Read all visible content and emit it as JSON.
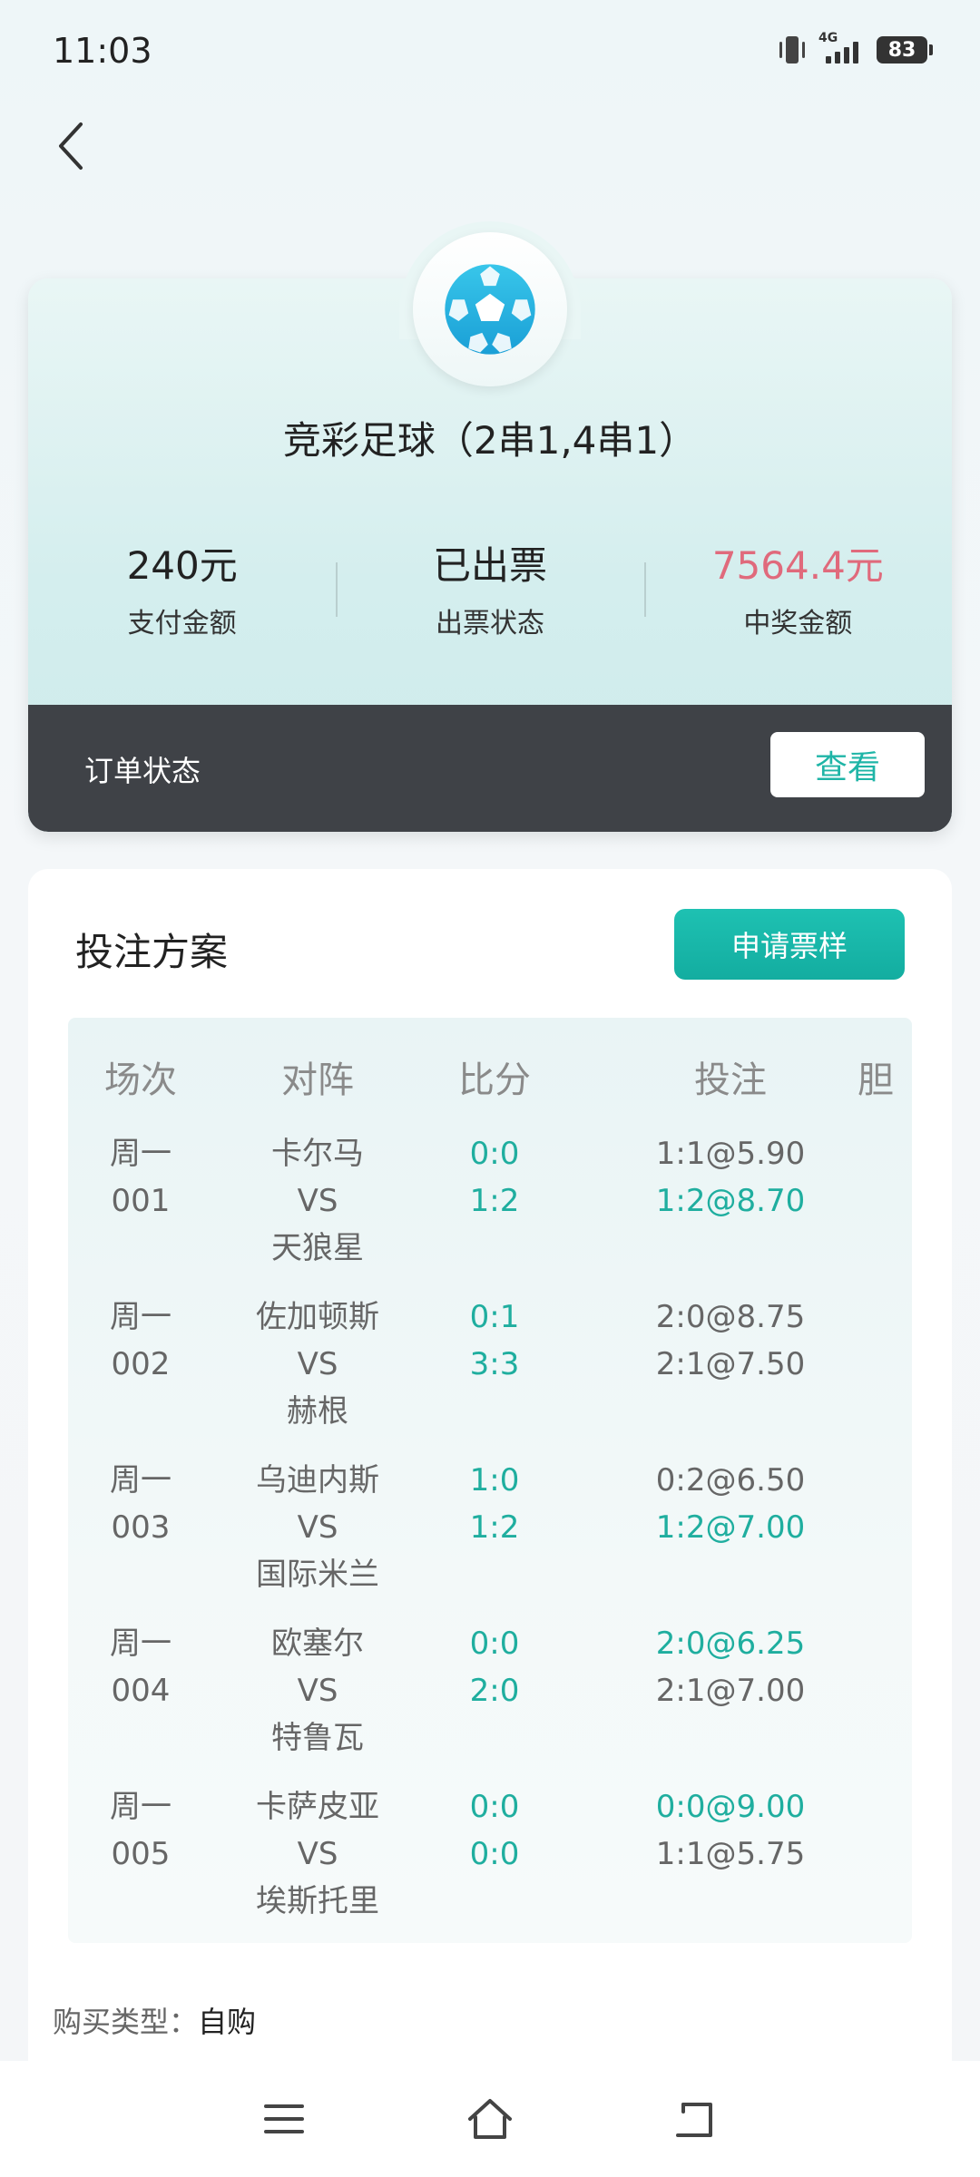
{
  "status_bar": {
    "time": "11:03",
    "network": "4G",
    "battery": "83"
  },
  "header": {
    "back_label": ""
  },
  "order": {
    "title": "竞彩足球（2串1,4串1）",
    "stats": [
      {
        "value": "240元",
        "label": "支付金额"
      },
      {
        "value": "已出票",
        "label": "出票状态"
      },
      {
        "value": "7564.4元",
        "label": "中奖金额"
      }
    ],
    "status_label": "订单状态",
    "view_label": "查看",
    "prize_color": "#e06a7c",
    "accent_color": "#1fb5a7"
  },
  "plan": {
    "title": "投注方案",
    "apply_label": "申请票样",
    "columns": [
      "场次",
      "对阵",
      "比分",
      "投注",
      "胆"
    ],
    "rows": [
      {
        "day": "周一",
        "num": "001",
        "home": "卡尔马",
        "vs": "VS",
        "away": "天狼星",
        "score1": "0:0",
        "score2": "1:2",
        "bet1": "1:1@5.90",
        "bet2": "1:2@8.70",
        "bet1_hit": false,
        "bet2_hit": true
      },
      {
        "day": "周一",
        "num": "002",
        "home": "佐加顿斯",
        "vs": "VS",
        "away": "赫根",
        "score1": "0:1",
        "score2": "3:3",
        "bet1": "2:0@8.75",
        "bet2": "2:1@7.50",
        "bet1_hit": false,
        "bet2_hit": false
      },
      {
        "day": "周一",
        "num": "003",
        "home": "乌迪内斯",
        "vs": "VS",
        "away": "国际米兰",
        "score1": "1:0",
        "score2": "1:2",
        "bet1": "0:2@6.50",
        "bet2": "1:2@7.00",
        "bet1_hit": false,
        "bet2_hit": true
      },
      {
        "day": "周一",
        "num": "004",
        "home": "欧塞尔",
        "vs": "VS",
        "away": "特鲁瓦",
        "score1": "0:0",
        "score2": "2:0",
        "bet1": "2:0@6.25",
        "bet2": "2:1@7.00",
        "bet1_hit": true,
        "bet2_hit": false
      },
      {
        "day": "周一",
        "num": "005",
        "home": "卡萨皮亚",
        "vs": "VS",
        "away": "埃斯托里",
        "score1": "0:0",
        "score2": "0:0",
        "bet1": "0:0@9.00",
        "bet2": "1:1@5.75",
        "bet1_hit": true,
        "bet2_hit": false
      }
    ],
    "purchase_label": "购买类型：",
    "purchase_value": "自购"
  },
  "nav": {
    "icons": [
      "menu-icon",
      "home-icon",
      "back-nav-icon"
    ]
  }
}
